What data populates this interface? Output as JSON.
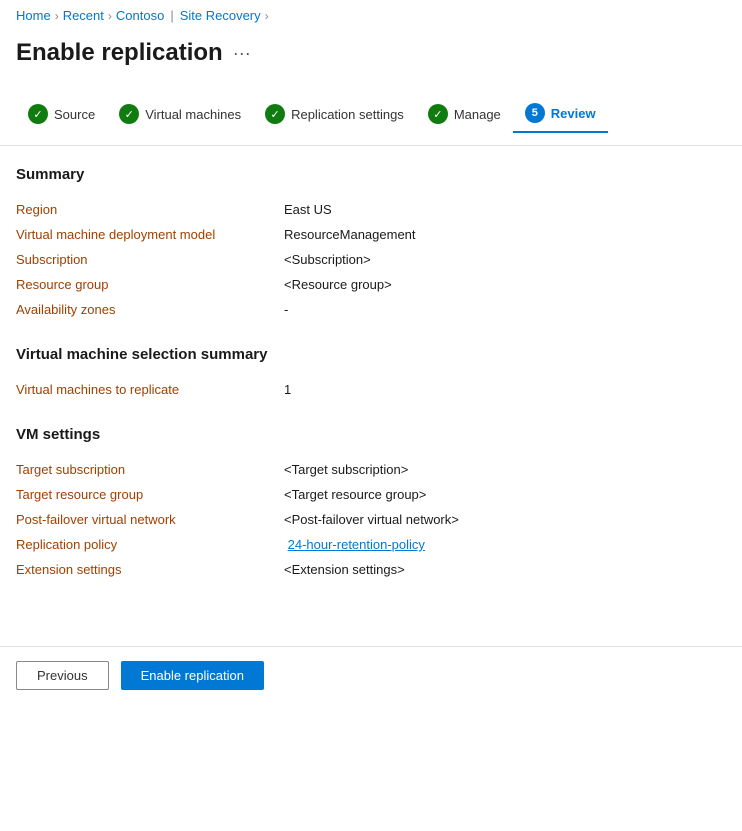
{
  "breadcrumb": {
    "items": [
      {
        "label": "Home",
        "href": "#"
      },
      {
        "label": "Recent",
        "href": "#"
      },
      {
        "label": "Contoso",
        "href": "#"
      },
      {
        "label": "Site Recovery",
        "href": "#"
      }
    ]
  },
  "page": {
    "title": "Enable replication",
    "menu_icon": "···"
  },
  "steps": [
    {
      "label": "Source",
      "state": "complete"
    },
    {
      "label": "Virtual machines",
      "state": "complete"
    },
    {
      "label": "Replication settings",
      "state": "complete"
    },
    {
      "label": "Manage",
      "state": "complete"
    },
    {
      "label": "Review",
      "state": "active",
      "number": "5"
    }
  ],
  "summary_section": {
    "title": "Summary",
    "rows": [
      {
        "label": "Region",
        "value": "East US",
        "type": "text"
      },
      {
        "label": "Virtual machine deployment model",
        "value": "ResourceManagement",
        "type": "text"
      },
      {
        "label": "Subscription",
        "value": "<Subscription>",
        "type": "text"
      },
      {
        "label": "Resource group",
        "value": "<Resource group>",
        "type": "text"
      },
      {
        "label": "Availability zones",
        "value": "-",
        "type": "text"
      }
    ]
  },
  "vm_selection_section": {
    "title": "Virtual machine selection summary",
    "rows": [
      {
        "label": "Virtual machines to replicate",
        "value": "1",
        "type": "text"
      }
    ]
  },
  "vm_settings_section": {
    "title": "VM settings",
    "rows": [
      {
        "label": "Target subscription",
        "value": "<Target subscription>",
        "type": "text"
      },
      {
        "label": "Target resource group",
        "value": "<Target resource group>",
        "type": "text"
      },
      {
        "label": "Post-failover virtual network",
        "value": "<Post-failover virtual network>",
        "type": "text"
      },
      {
        "label": "Replication policy",
        "value": "24-hour-retention-policy",
        "type": "link"
      },
      {
        "label": "Extension settings",
        "value": "<Extension settings>",
        "type": "text"
      }
    ]
  },
  "footer": {
    "previous_label": "Previous",
    "enable_label": "Enable replication"
  }
}
